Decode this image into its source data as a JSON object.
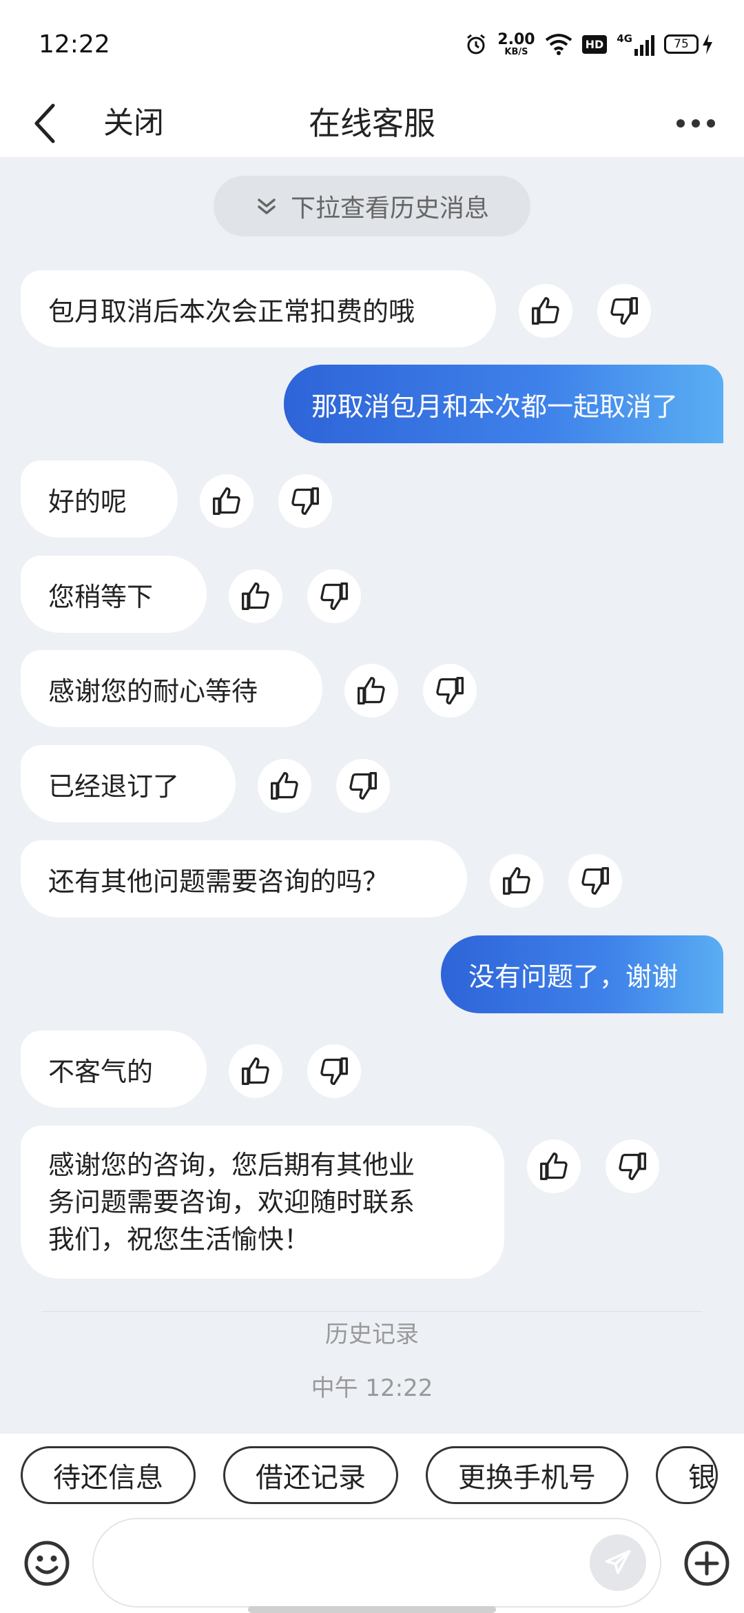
{
  "status_bar": {
    "time": "12:22",
    "net_speed_value": "2.00",
    "net_speed_unit": "KB/S",
    "hd": "HD",
    "network": "4G",
    "battery": "75"
  },
  "nav": {
    "close_label": "关闭",
    "title": "在线客服"
  },
  "history_pill": "下拉查看历史消息",
  "messages": [
    {
      "side": "left",
      "text": "包月取消后本次会正常扣费的哦"
    },
    {
      "side": "right",
      "text": "那取消包月和本次都一起取消了"
    },
    {
      "side": "left",
      "text": "好的呢"
    },
    {
      "side": "left",
      "text": "您稍等下"
    },
    {
      "side": "left",
      "text": "感谢您的耐心等待"
    },
    {
      "side": "left",
      "text": "已经退订了"
    },
    {
      "side": "left",
      "text": "还有其他问题需要咨询的吗？"
    },
    {
      "side": "right",
      "text": "没有问题了，谢谢"
    },
    {
      "side": "left",
      "text": "不客气的"
    },
    {
      "side": "left",
      "lines": [
        "感谢您的咨询，您后期有其他业",
        "务问题需要咨询，欢迎随时联系",
        "我们，祝您生活愉快！"
      ]
    }
  ],
  "history_record_label": "历史记录",
  "timestamp": "中午 12:22",
  "quick_actions": [
    "待还信息",
    "借还记录",
    "更换手机号",
    "银"
  ],
  "icons": {
    "back": "chevron-left-icon",
    "more": "more-dots-icon",
    "like": "thumbs-up-icon",
    "dislike": "thumbs-down-icon",
    "emoji": "smiley-icon",
    "send": "send-icon",
    "plus": "plus-icon"
  },
  "colors": {
    "accent_gradient_start": "#2e64d8",
    "accent_gradient_end": "#5aaef3",
    "background": "#edf0f5"
  }
}
